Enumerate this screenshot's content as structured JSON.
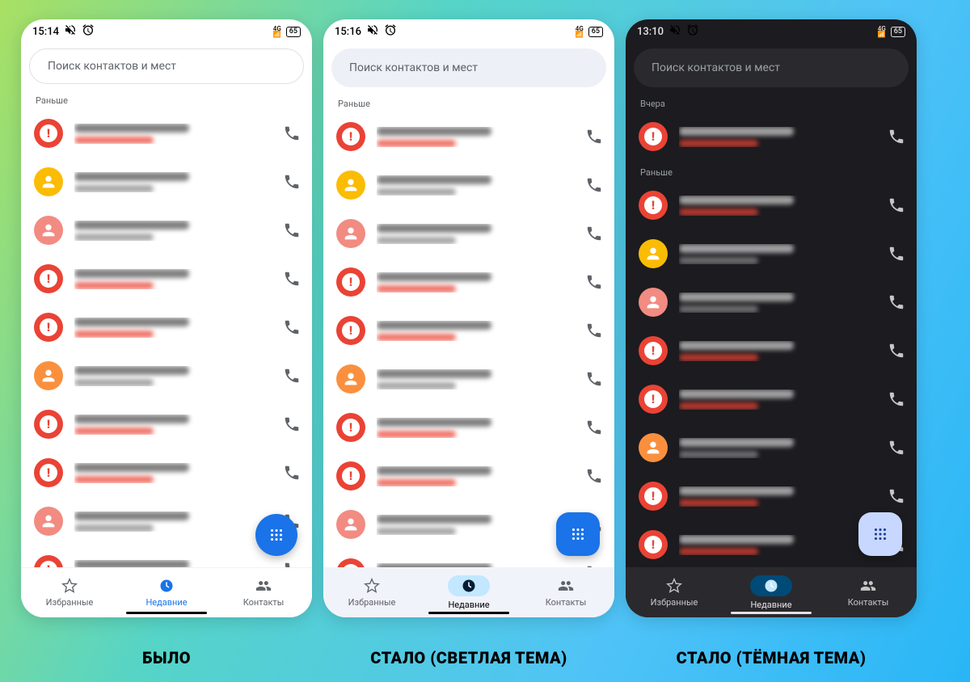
{
  "captions": {
    "before": "БЫЛО",
    "after_light": "СТАЛО (СВЕТЛАЯ ТЕМА)",
    "after_dark": "СТАЛО (ТЁМНАЯ ТЕМА)"
  },
  "search_placeholder": "Поиск контактов и мест",
  "nav": {
    "favorites": "Избранные",
    "recent": "Недавние",
    "contacts": "Контакты"
  },
  "sections": {
    "earlier": "Раньше",
    "yesterday": "Вчера"
  },
  "battery_pct": "65",
  "screens": [
    {
      "id": "before",
      "theme": "light-old",
      "time": "15:14",
      "groups": [
        {
          "label_key": "earlier",
          "rows": [
            {
              "type": "warn",
              "sub": "red"
            },
            {
              "type": "person",
              "color": "#fbbc04",
              "sub": "gray"
            },
            {
              "type": "person",
              "color": "#f28b82",
              "sub": "gray"
            },
            {
              "type": "warn",
              "sub": "red"
            },
            {
              "type": "warn",
              "sub": "red"
            },
            {
              "type": "person",
              "color": "#fa903e",
              "sub": "gray"
            },
            {
              "type": "warn",
              "sub": "red"
            },
            {
              "type": "warn",
              "sub": "red"
            },
            {
              "type": "person",
              "color": "#f28b82",
              "sub": "gray"
            },
            {
              "type": "warn",
              "sub": "red"
            }
          ]
        }
      ]
    },
    {
      "id": "after-light",
      "theme": "light-m3",
      "time": "15:16",
      "groups": [
        {
          "label_key": "earlier",
          "rows": [
            {
              "type": "warn",
              "sub": "red"
            },
            {
              "type": "person",
              "color": "#fbbc04",
              "sub": "gray"
            },
            {
              "type": "person",
              "color": "#f28b82",
              "sub": "gray"
            },
            {
              "type": "warn",
              "sub": "red"
            },
            {
              "type": "warn",
              "sub": "red"
            },
            {
              "type": "person",
              "color": "#fa903e",
              "sub": "gray"
            },
            {
              "type": "warn",
              "sub": "red"
            },
            {
              "type": "warn",
              "sub": "red"
            },
            {
              "type": "person",
              "color": "#f28b82",
              "sub": "gray"
            },
            {
              "type": "warn",
              "sub": "red"
            }
          ]
        }
      ]
    },
    {
      "id": "after-dark",
      "theme": "dark",
      "time": "13:10",
      "groups": [
        {
          "label_key": "yesterday",
          "rows": [
            {
              "type": "warn",
              "sub": "red"
            }
          ]
        },
        {
          "label_key": "earlier",
          "rows": [
            {
              "type": "warn",
              "sub": "red"
            },
            {
              "type": "person",
              "color": "#fbbc04",
              "sub": "gray"
            },
            {
              "type": "person",
              "color": "#f28b82",
              "sub": "gray"
            },
            {
              "type": "warn",
              "sub": "red"
            },
            {
              "type": "warn",
              "sub": "red"
            },
            {
              "type": "person",
              "color": "#fa903e",
              "sub": "gray"
            },
            {
              "type": "warn",
              "sub": "red"
            },
            {
              "type": "warn",
              "sub": "red"
            }
          ]
        }
      ]
    }
  ]
}
